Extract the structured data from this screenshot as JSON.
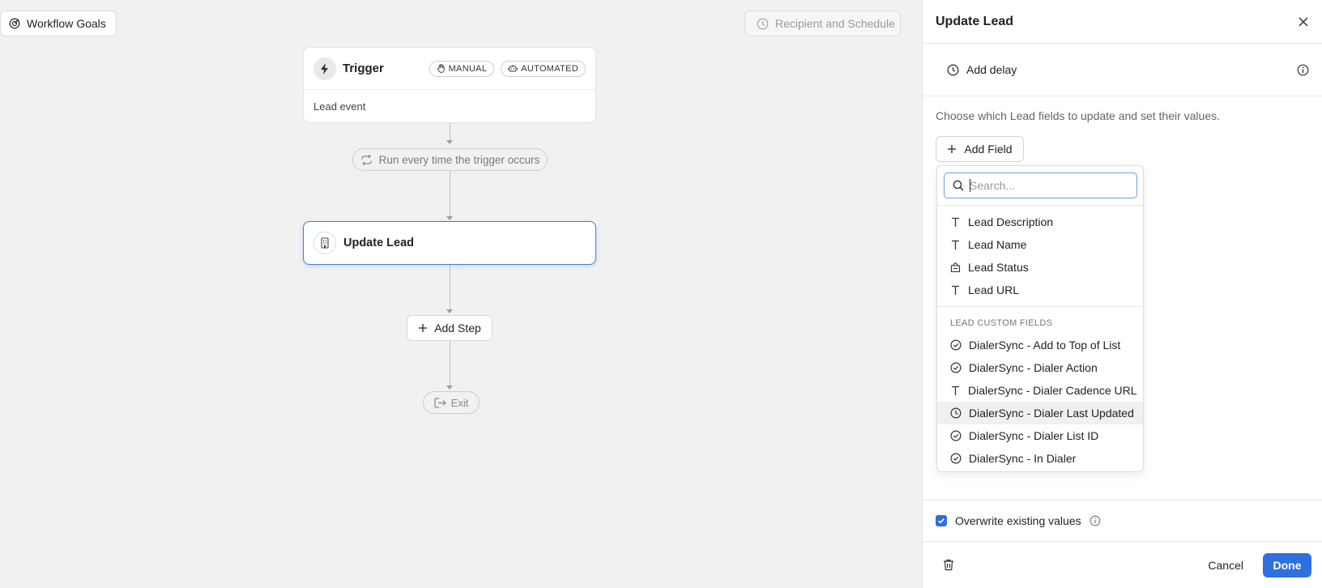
{
  "canvas": {
    "goals_label": "Workflow Goals",
    "recipient_label": "Recipient and Schedule",
    "trigger": {
      "title": "Trigger",
      "manual_label": "MANUAL",
      "automated_label": "AUTOMATED",
      "subtitle": "Lead event"
    },
    "run_label": "Run every time the trigger occurs",
    "update_step_title": "Update Lead",
    "add_step_label": "Add Step",
    "exit_label": "Exit"
  },
  "panel": {
    "title": "Update Lead",
    "add_delay_label": "Add delay",
    "hint": "Choose which Lead fields to update and set their values.",
    "add_field_label": "Add Field",
    "search_placeholder": "Search...",
    "standard_fields": [
      {
        "label": "Lead Description",
        "icon": "text-type-icon"
      },
      {
        "label": "Lead Name",
        "icon": "text-type-icon"
      },
      {
        "label": "Lead Status",
        "icon": "status-icon"
      },
      {
        "label": "Lead URL",
        "icon": "text-type-icon"
      }
    ],
    "custom_group_label": "LEAD CUSTOM FIELDS",
    "custom_fields": [
      {
        "label": "DialerSync - Add to Top of List",
        "icon": "check-circle-icon"
      },
      {
        "label": "DialerSync - Dialer Action",
        "icon": "check-circle-icon"
      },
      {
        "label": "DialerSync - Dialer Cadence URL",
        "icon": "text-type-icon"
      },
      {
        "label": "DialerSync - Dialer Last Updated",
        "icon": "clock-icon"
      },
      {
        "label": "DialerSync - Dialer List ID",
        "icon": "check-circle-icon"
      },
      {
        "label": "DialerSync - In Dialer",
        "icon": "check-circle-icon"
      }
    ],
    "overwrite_label": "Overwrite existing values",
    "overwrite_checked": true,
    "cancel_label": "Cancel",
    "done_label": "Done"
  },
  "colors": {
    "accent": "#2f6fe0",
    "selected_border": "#3b7be8",
    "canvas_bg": "#f1f1f1"
  }
}
